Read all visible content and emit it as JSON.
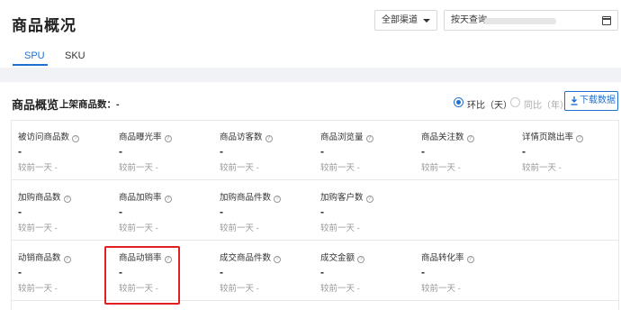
{
  "header": {
    "title": "商品概况",
    "channel_select": "全部渠道",
    "date_mode": "按天查询"
  },
  "tabs": [
    {
      "label": "SPU",
      "active": true
    },
    {
      "label": "SKU",
      "active": false
    }
  ],
  "section": {
    "title": "商品概览",
    "listed_label": "上架商品数：-",
    "compare_options": [
      {
        "label": "环比（天）",
        "checked": true
      },
      {
        "label": "同比（年）",
        "checked": false
      }
    ],
    "download_label": "下载数据"
  },
  "metrics": [
    [
      {
        "label": "被访问商品数",
        "value": "-",
        "compare": "较前一天   -"
      },
      {
        "label": "商品曝光率",
        "value": "-",
        "compare": "较前一天   -"
      },
      {
        "label": "商品访客数",
        "value": "-",
        "compare": "较前一天   -"
      },
      {
        "label": "商品浏览量",
        "value": "-",
        "compare": "较前一天   -"
      },
      {
        "label": "商品关注数",
        "value": "-",
        "compare": "较前一天   -"
      },
      {
        "label": "详情页跳出率",
        "value": "-",
        "compare": "较前一天   -"
      }
    ],
    [
      {
        "label": "加购商品数",
        "value": "-",
        "compare": "较前一天   -"
      },
      {
        "label": "商品加购率",
        "value": "-",
        "compare": "较前一天   -"
      },
      {
        "label": "加购商品件数",
        "value": "-",
        "compare": "较前一天   -"
      },
      {
        "label": "加购客户数",
        "value": "-",
        "compare": "较前一天   -"
      }
    ],
    [
      {
        "label": "动销商品数",
        "value": "-",
        "compare": "较前一天   -"
      },
      {
        "label": "商品动销率",
        "value": "-",
        "compare": "较前一天   -"
      },
      {
        "label": "成交商品件数",
        "value": "-",
        "compare": "较前一天   -"
      },
      {
        "label": "成交金额",
        "value": "-",
        "compare": "较前一天   -"
      },
      {
        "label": "商品转化率",
        "value": "-",
        "compare": "较前一天   -"
      }
    ]
  ],
  "help_glyph": "?",
  "colors": {
    "accent": "#1f6fd1",
    "highlight": "#e02020"
  }
}
